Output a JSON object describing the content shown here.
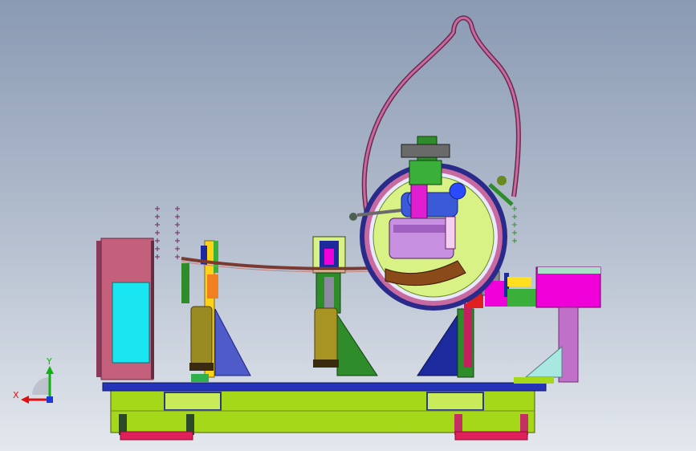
{
  "axis_triad": {
    "x_label": "X",
    "y_label": "Y",
    "x_color": "#e01010",
    "y_color": "#10b010",
    "z_color": "#1a3ad8"
  },
  "colors": {
    "base_lime": "#a6d81a",
    "top_plate_blue": "#2433b8",
    "pink_cabinet": "#c4607c",
    "cyan_panel": "#19e6f0",
    "gantry_green": "#2f8c2a",
    "left_support_blue": "#4f5bc9",
    "right_support_blue": "#1c2a9e",
    "hanger_pink": "#c86aa0",
    "ring_yellow_green": "#d9f285",
    "cylinder_olive": "#8a7a1a",
    "magenta_box": "#f000d8",
    "rail_red": "#e0205a"
  }
}
